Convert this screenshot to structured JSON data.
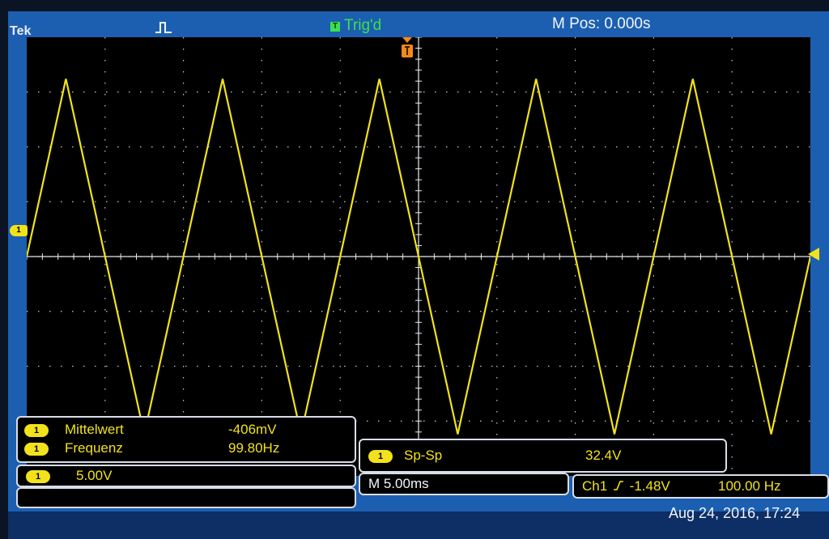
{
  "colors": {
    "bezel": "#0b1424",
    "screen_blue": "#1c5fb0",
    "plot_background": "#000000",
    "grid": "#c9ccd4",
    "trace_ch1": "#f2e21b",
    "status_triggered": "#3be04f",
    "text_white": "#f2f5fa"
  },
  "header": {
    "brand": "Tek",
    "acquisition_icon": "pulse-icon",
    "trigger_badge": "T",
    "trigger_status": "Trig'd",
    "horizontal_position": "M Pos: 0.000s"
  },
  "markers": {
    "channel_ground": "1",
    "trigger_position_icon": "trigger-position-icon",
    "trigger_level_icon": "trigger-level-arrow-icon"
  },
  "measurements": [
    {
      "channel": "1",
      "label": "Mittelwert",
      "value": "-406mV"
    },
    {
      "channel": "1",
      "label": "Frequenz",
      "value": "99.80Hz"
    }
  ],
  "peak_to_peak": {
    "channel": "1",
    "label": "Sp-Sp",
    "value": "32.4V"
  },
  "channel_scale": {
    "channel": "1",
    "value": "5.00V"
  },
  "timebase": "M 5.00ms",
  "trigger": {
    "source": "Ch1",
    "slope_icon": "rising-edge-icon",
    "level": "-1.48V",
    "frequency": "100.00 Hz"
  },
  "datetime": "Aug 24, 2016, 17:24",
  "chart_data": {
    "type": "line",
    "x": [
      -25.0,
      -22.5,
      -17.5,
      -12.5,
      -7.5,
      -2.5,
      2.5,
      7.5,
      12.5,
      17.5,
      22.5,
      25.0
    ],
    "series": [
      {
        "values": [
          0.0,
          16.2,
          -16.2,
          16.2,
          -16.2,
          16.2,
          -16.2,
          16.2,
          -16.2,
          16.2,
          -16.2,
          0.0
        ]
      }
    ],
    "xlim": [
      -25,
      25
    ],
    "ylim": [
      -20,
      20
    ],
    "grid": true
  }
}
